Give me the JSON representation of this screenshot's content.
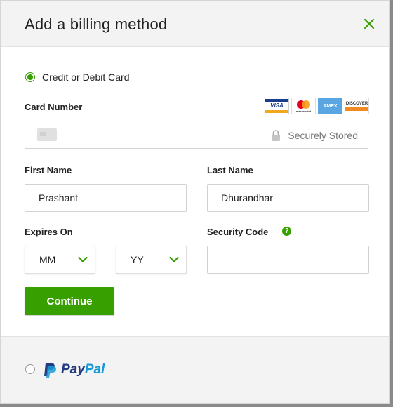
{
  "modal": {
    "title": "Add a billing method"
  },
  "credit_card": {
    "option_label": "Credit or Debit Card",
    "selected": true,
    "card_number_label": "Card Number",
    "card_number_value": "",
    "secure_label": "Securely Stored",
    "card_logos": [
      "VISA",
      "mastercard",
      "AMEX",
      "DISCOVER"
    ],
    "first_name_label": "First Name",
    "first_name_value": "Prashant",
    "last_name_label": "Last Name",
    "last_name_value": "Dhurandhar",
    "expires_label": "Expires On",
    "month_value": "MM",
    "year_value": "YY",
    "security_code_label": "Security Code",
    "security_code_value": "",
    "continue_label": "Continue"
  },
  "paypal": {
    "word_pay": "Pay",
    "word_pal": "Pal",
    "selected": false
  },
  "colors": {
    "accent": "#37a000",
    "paypal_dark": "#253b80",
    "paypal_light": "#179bd7"
  },
  "icons": {
    "close": "close-icon",
    "lock": "lock-icon",
    "chevron": "chevron-down-icon",
    "help": "question-circle-icon",
    "card": "card-placeholder-icon"
  }
}
